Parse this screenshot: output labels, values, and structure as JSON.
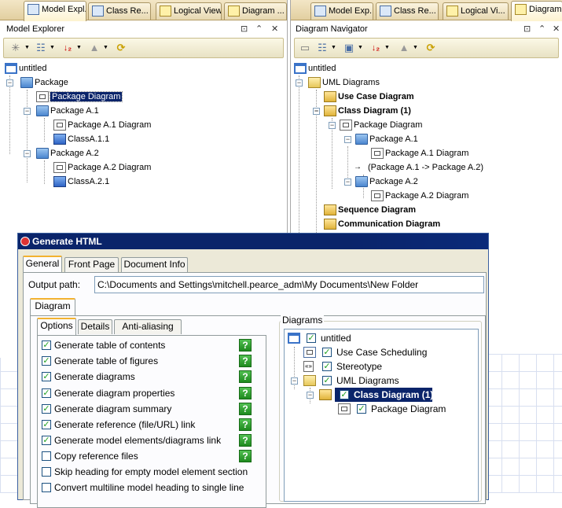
{
  "left_pane": {
    "tabs": [
      "Model Expl...",
      "Class Re...",
      "Logical View",
      "Diagram ..."
    ],
    "title": "Model Explorer",
    "tree": [
      {
        "label": "untitled"
      },
      {
        "label": "Package"
      },
      {
        "label": "Package Diagram"
      },
      {
        "label": "Package A.1"
      },
      {
        "label": "Package A.1 Diagram"
      },
      {
        "label": "ClassA.1.1"
      },
      {
        "label": "Package A.2"
      },
      {
        "label": "Package A.2 Diagram"
      },
      {
        "label": "ClassA.2.1"
      }
    ]
  },
  "right_pane": {
    "tabs": [
      "Model Exp...",
      "Class Re...",
      "Logical Vi...",
      "Diagram"
    ],
    "title": "Diagram Navigator",
    "tree": [
      {
        "label": "untitled"
      },
      {
        "label": "UML Diagrams"
      },
      {
        "label": "Use Case Diagram"
      },
      {
        "label": "Class Diagram (1)"
      },
      {
        "label": "Package Diagram"
      },
      {
        "label": "Package A.1"
      },
      {
        "label": "Package A.1 Diagram"
      },
      {
        "label": "(Package A.1 -> Package A.2)"
      },
      {
        "label": "Package A.2"
      },
      {
        "label": "Package A.2 Diagram"
      },
      {
        "label": "Sequence Diagram"
      },
      {
        "label": "Communication Diagram"
      }
    ]
  },
  "dialog": {
    "title": "Generate HTML",
    "tabs": [
      "General",
      "Front Page",
      "Document Info"
    ],
    "output_label": "Output path:",
    "output_path": "C:\\Documents and Settings\\mitchell.pearce_adm\\My Documents\\New Folder",
    "diagram_tab": "Diagram",
    "option_tabs": [
      "Options",
      "Details",
      "Anti-aliasing"
    ],
    "options": [
      {
        "label": "Generate table of contents",
        "checked": true,
        "help": "?"
      },
      {
        "label": "Generate table of figures",
        "checked": true,
        "help": "?"
      },
      {
        "label": "Generate diagrams",
        "checked": true,
        "help": "?"
      },
      {
        "label": "Generate diagram properties",
        "checked": true,
        "help": "?"
      },
      {
        "label": "Generate diagram summary",
        "checked": true,
        "help": "?"
      },
      {
        "label": "Generate reference (file/URL) link",
        "checked": true,
        "help": "?"
      },
      {
        "label": "Generate model elements/diagrams link",
        "checked": true,
        "help": "?"
      },
      {
        "label": "Copy reference files",
        "checked": false,
        "help": "?"
      },
      {
        "label": "Skip heading for empty model element section",
        "checked": false
      },
      {
        "label": "Convert multiline model heading to single line",
        "checked": false
      }
    ],
    "diagrams_group": "Diagrams",
    "diagrams_tree": [
      {
        "label": "untitled",
        "checked": true
      },
      {
        "label": "Use Case Scheduling",
        "checked": true
      },
      {
        "label": "Stereotype",
        "checked": true
      },
      {
        "label": "UML Diagrams",
        "checked": true
      },
      {
        "label": "Class Diagram (1)",
        "checked": true
      },
      {
        "label": "Package Diagram",
        "checked": true
      }
    ]
  }
}
